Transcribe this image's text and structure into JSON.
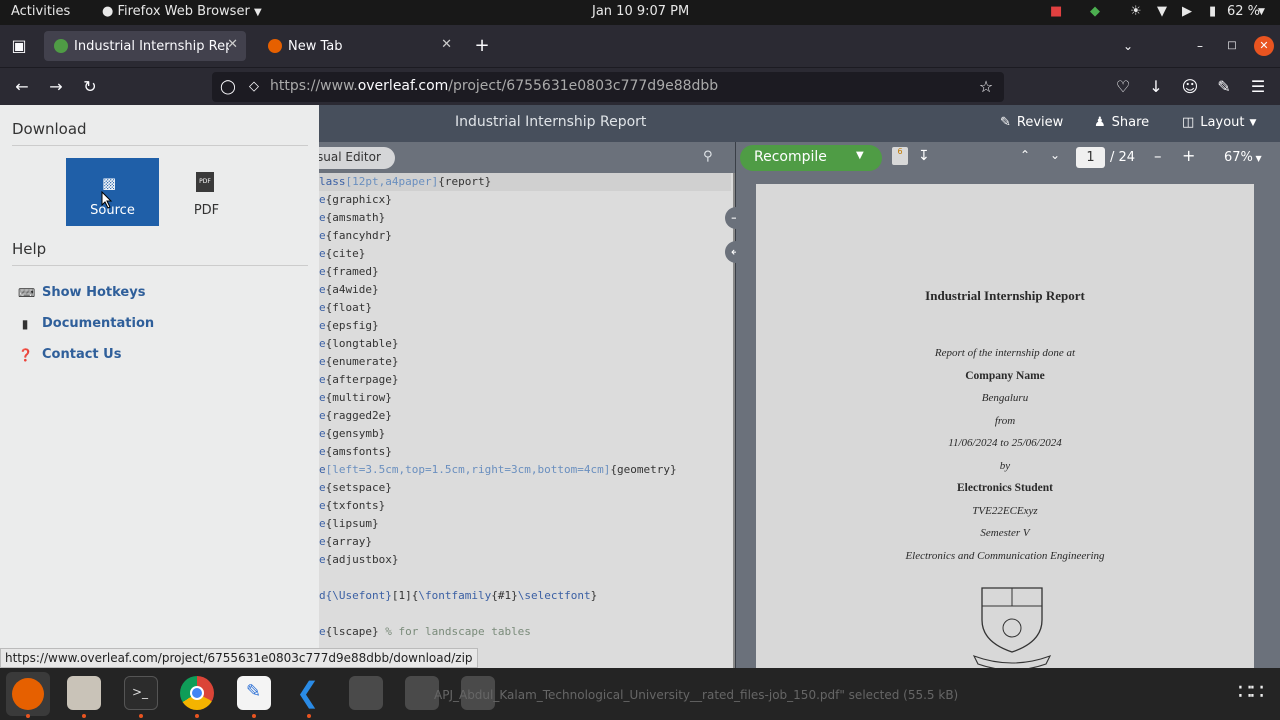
{
  "topbar": {
    "activities": "Activities",
    "app_name": "Firefox Web Browser",
    "clock": "Jan 10  9:07 PM",
    "battery": "62 %"
  },
  "tabs": [
    {
      "title": "Industrial Internship Rep"
    },
    {
      "title": "New Tab"
    }
  ],
  "url": {
    "prefix": "https://www.",
    "domain": "overleaf.com",
    "path": "/project/6755631e0803c777d9e88dbb"
  },
  "overleaf": {
    "project_title": "Industrial Internship Report",
    "review": "Review",
    "share": "Share",
    "layout": "Layout",
    "visual_editor": "sual Editor",
    "recompile": "Recompile",
    "page_current": "1",
    "page_total": "/ 24",
    "zoom": "67%",
    "badge_count": "6"
  },
  "left_menu": {
    "download_heading": "Download",
    "source_label": "Source",
    "pdf_label": "PDF",
    "help_heading": "Help",
    "links": [
      "Show Hotkeys",
      "Documentation",
      "Contact Us"
    ]
  },
  "code_lines": [
    [
      [
        "kw",
        "lass"
      ],
      [
        "opt",
        "[12pt,a4paper]"
      ],
      [
        "txt",
        "{report}"
      ]
    ],
    [
      [
        "kw",
        "e"
      ],
      [
        "txt",
        "{graphicx}"
      ]
    ],
    [
      [
        "kw",
        "e"
      ],
      [
        "txt",
        "{amsmath}"
      ]
    ],
    [
      [
        "kw",
        "e"
      ],
      [
        "txt",
        "{fancyhdr}"
      ]
    ],
    [
      [
        "kw",
        "e"
      ],
      [
        "txt",
        "{cite}"
      ]
    ],
    [
      [
        "kw",
        "e"
      ],
      [
        "txt",
        "{framed}"
      ]
    ],
    [
      [
        "kw",
        "e"
      ],
      [
        "txt",
        "{a4wide}"
      ]
    ],
    [
      [
        "kw",
        "e"
      ],
      [
        "txt",
        "{float}"
      ]
    ],
    [
      [
        "kw",
        "e"
      ],
      [
        "txt",
        "{epsfig}"
      ]
    ],
    [
      [
        "kw",
        "e"
      ],
      [
        "txt",
        "{longtable}"
      ]
    ],
    [
      [
        "kw",
        "e"
      ],
      [
        "txt",
        "{enumerate}"
      ]
    ],
    [
      [
        "kw",
        "e"
      ],
      [
        "txt",
        "{afterpage}"
      ]
    ],
    [
      [
        "kw",
        "e"
      ],
      [
        "txt",
        "{multirow}"
      ]
    ],
    [
      [
        "kw",
        "e"
      ],
      [
        "txt",
        "{ragged2e}"
      ]
    ],
    [
      [
        "kw",
        "e"
      ],
      [
        "txt",
        "{gensymb}"
      ]
    ],
    [
      [
        "kw",
        "e"
      ],
      [
        "txt",
        "{amsfonts}"
      ]
    ],
    [
      [
        "kw",
        "e"
      ],
      [
        "opt",
        "[left=3.5cm,top=1.5cm,right=3cm,bottom=4cm]"
      ],
      [
        "txt",
        "{geometry}"
      ]
    ],
    [
      [
        "kw",
        "e"
      ],
      [
        "txt",
        "{setspace}"
      ]
    ],
    [
      [
        "kw",
        "e"
      ],
      [
        "txt",
        "{txfonts}"
      ]
    ],
    [
      [
        "kw",
        "e"
      ],
      [
        "txt",
        "{lipsum}"
      ]
    ],
    [
      [
        "kw",
        "e"
      ],
      [
        "txt",
        "{array}"
      ]
    ],
    [
      [
        "kw",
        "e"
      ],
      [
        "txt",
        "{adjustbox}"
      ]
    ],
    [],
    [
      [
        "kw",
        "d{\\Usefont}"
      ],
      [
        "txt",
        "[1]{"
      ],
      [
        "kw",
        "\\fontfamily"
      ],
      [
        "txt",
        "{#1}"
      ],
      [
        "kw",
        "\\selectfont"
      ],
      [
        "txt",
        "}"
      ]
    ],
    [],
    [
      [
        "kw",
        "e"
      ],
      [
        "txt",
        "{lscape} "
      ],
      [
        "cm",
        "% for landscape tables"
      ]
    ]
  ],
  "pdf": {
    "title": "Industrial Internship Report",
    "lines": [
      {
        "text": "Report of the internship done at",
        "style": "italic"
      },
      {
        "text": "Company Name",
        "style": "bold"
      },
      {
        "text": "Bengaluru",
        "style": "italic"
      },
      {
        "text": "from",
        "style": "italic"
      },
      {
        "text": "11/06/2024 to 25/06/2024",
        "style": "italic"
      },
      {
        "text": "by",
        "style": "italic"
      },
      {
        "text": "Electronics Student",
        "style": "bold"
      },
      {
        "text": "TVE22ECExyz",
        "style": "italic"
      },
      {
        "text": "Semester V",
        "style": "italic"
      },
      {
        "text": "Electronics and Communication Engineering",
        "style": "italic"
      }
    ]
  },
  "status_url": "https://www.overleaf.com/project/6755631e0803c777d9e88dbb/download/zip",
  "download_notice": "APJ_Abdul_Kalam_Technological_University__rated_files-job_150.pdf\" selected  (55.5 kB)"
}
